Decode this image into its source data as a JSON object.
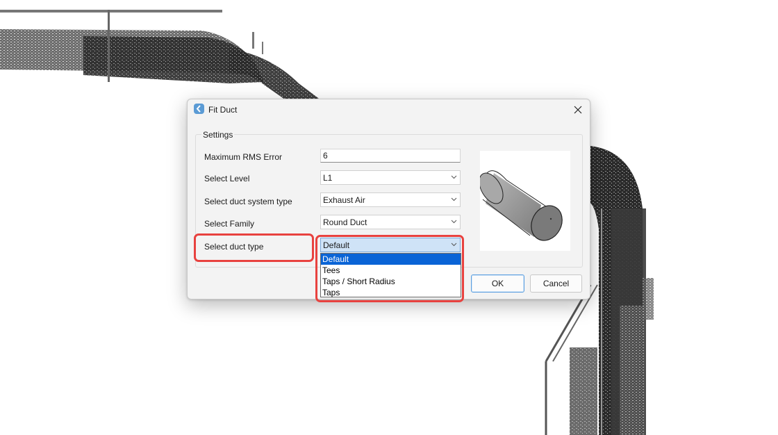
{
  "dialog": {
    "title": "Fit Duct",
    "group_title": "Settings",
    "fields": [
      {
        "label": "Maximum RMS Error",
        "value": "6",
        "kind": "text"
      },
      {
        "label": "Select Level",
        "value": "L1",
        "kind": "combo"
      },
      {
        "label": "Select duct system type",
        "value": "Exhaust Air",
        "kind": "combo"
      },
      {
        "label": "Select Family",
        "value": "Round Duct",
        "kind": "combo"
      },
      {
        "label": "Select duct type",
        "value": "Default",
        "kind": "combo-open"
      }
    ],
    "duct_type_options": [
      "Default",
      "Tees",
      "Taps / Short Radius",
      "Taps"
    ],
    "selected_option": "Default",
    "ok_label": "OK",
    "cancel_label": "Cancel"
  },
  "icons": {
    "title": "fit-duct-app-icon",
    "close": "close-icon",
    "dropdown": "chevron-down-icon",
    "preview": "cylinder-duct-preview"
  },
  "colors": {
    "highlight": "#e8423f",
    "selection": "#0a64d6",
    "accent": "#5a9ee0"
  }
}
